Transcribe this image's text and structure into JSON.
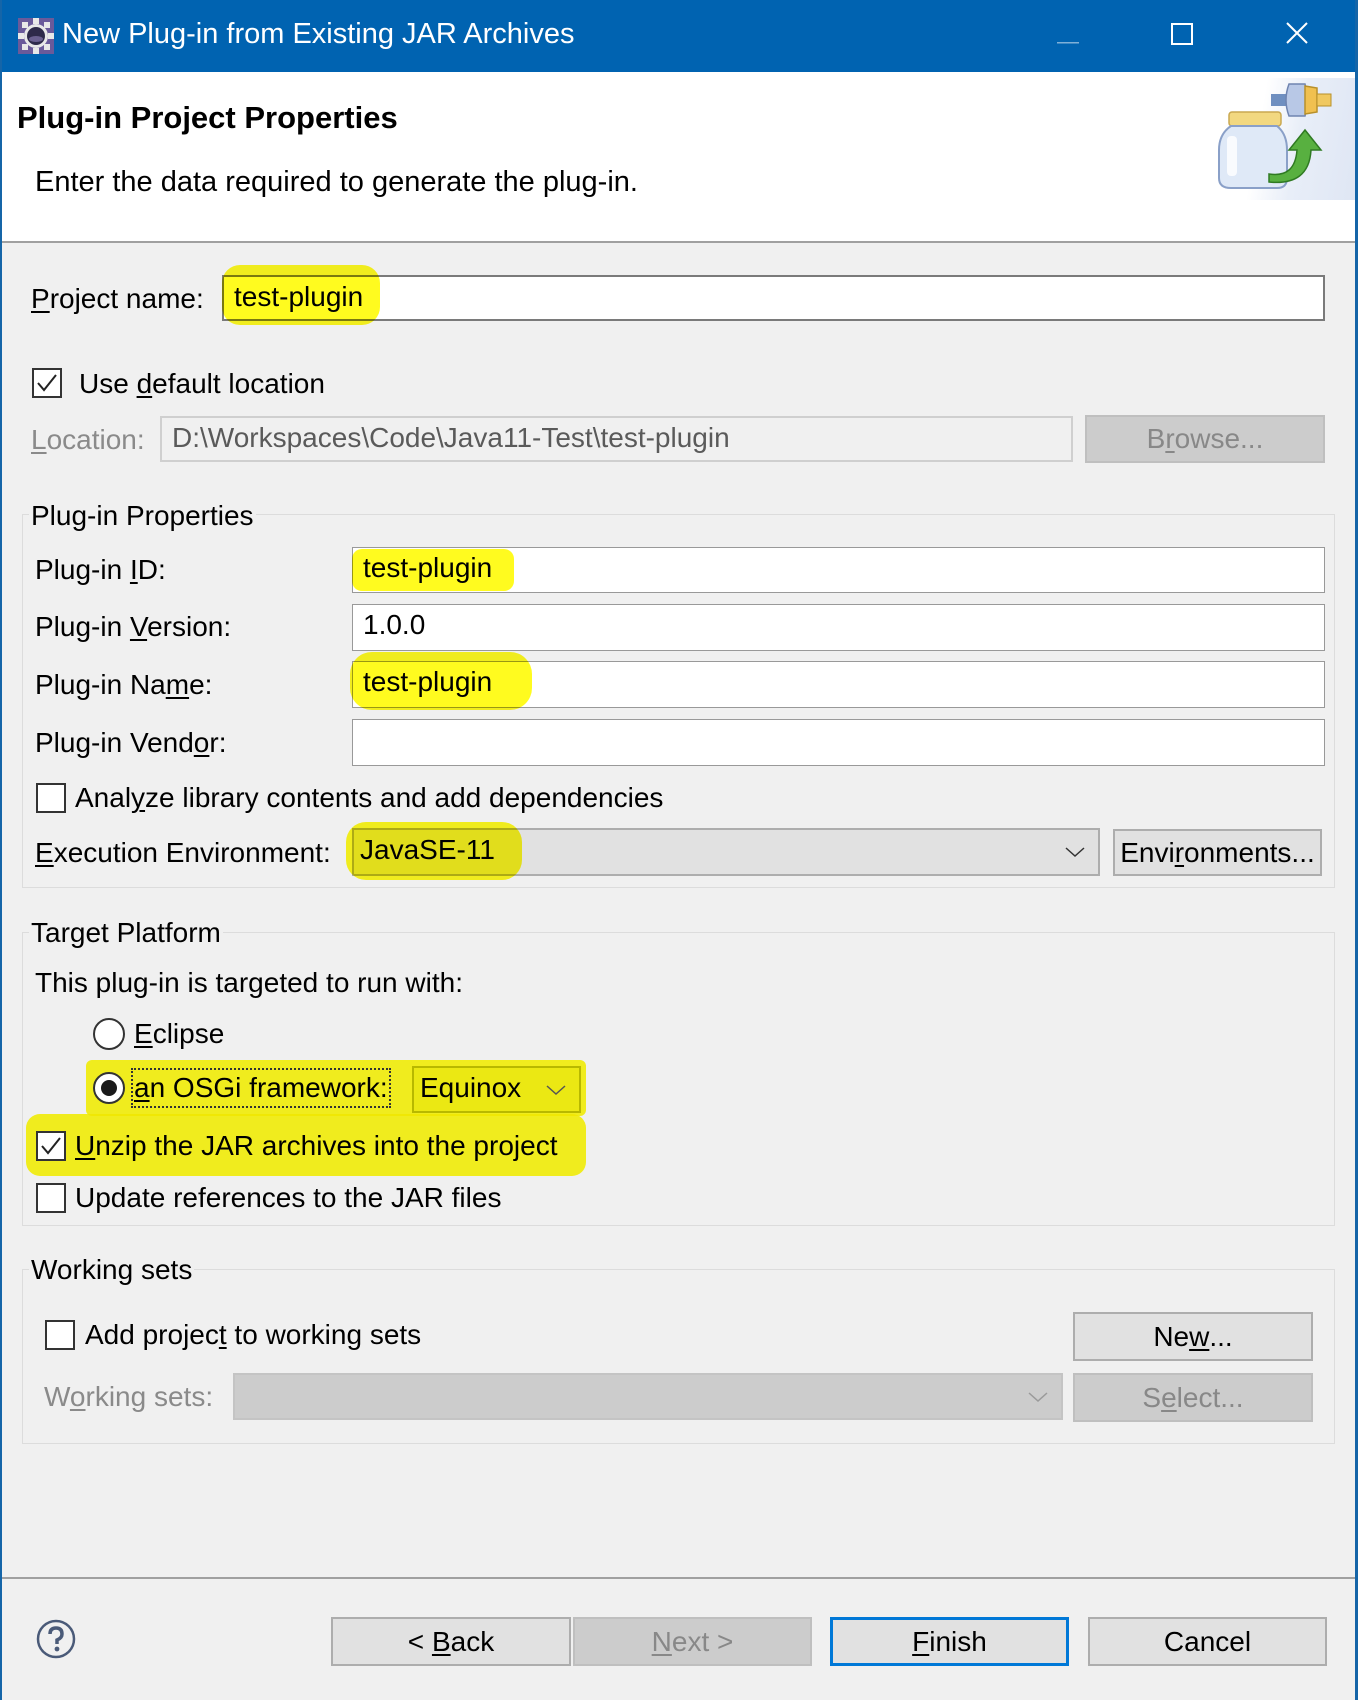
{
  "window": {
    "title": "New Plug-in from Existing JAR Archives",
    "app_icon": "eclipse-gear-icon",
    "controls": {
      "minimize": "minimize-icon",
      "maximize": "maximize-icon",
      "close": "close-icon"
    }
  },
  "header": {
    "title": "Plug-in Project Properties",
    "description": "Enter the data required to generate the plug-in.",
    "banner_icon": "jar-plugin-wizard-icon"
  },
  "project": {
    "name_label_mn": "P",
    "name_label_rest": "roject name:",
    "name_value": "test-plugin",
    "use_default_pre": "Use ",
    "use_default_mn": "d",
    "use_default_post": "efault location",
    "use_default_checked": true,
    "location_label_mn": "L",
    "location_label_rest": "ocation:",
    "location_value": "D:\\Workspaces\\Code\\Java11-Test\\test-plugin",
    "browse_pre": "B",
    "browse_mn": "r",
    "browse_post": "owse..."
  },
  "plugin_properties": {
    "group_title": "Plug-in Properties",
    "id_label_pre": "Plug-in ",
    "id_label_mn": "I",
    "id_label_post": "D:",
    "id_value": "test-plugin",
    "version_label_pre": "Plug-in ",
    "version_label_mn": "V",
    "version_label_post": "ersion:",
    "version_value": "1.0.0",
    "name_label_pre": "Plug-in Na",
    "name_label_mn": "m",
    "name_label_post": "e:",
    "name_value": "test-plugin",
    "vendor_label_pre": "Plug-in Vend",
    "vendor_label_mn": "o",
    "vendor_label_post": "r:",
    "vendor_value": "",
    "analyze_pre": "Anal",
    "analyze_mn": "y",
    "analyze_post": "ze library contents and add dependencies",
    "analyze_checked": false,
    "exec_env_label_mn": "E",
    "exec_env_label_rest": "xecution Environment:",
    "exec_env_value": "JavaSE-11",
    "environments_pre": "Envi",
    "environments_mn": "r",
    "environments_post": "onments..."
  },
  "target_platform": {
    "group_title": "Target Platform",
    "intro": "This plug-in is targeted to run with:",
    "eclipse_mn": "E",
    "eclipse_rest": "clipse",
    "eclipse_selected": false,
    "osgi_mn": "a",
    "osgi_rest": "n OSGi framework:",
    "osgi_selected": true,
    "osgi_framework_value": "Equinox",
    "unzip_mn": "U",
    "unzip_rest": "nzip the JAR archives into the project",
    "unzip_checked": true,
    "update_refs_label": "Update references to the JAR files",
    "update_refs_checked": false
  },
  "working_sets": {
    "group_title": "Working sets",
    "add_pre": "Add projec",
    "add_mn": "t",
    "add_post": " to working sets",
    "add_checked": false,
    "new_pre": "Ne",
    "new_mn": "w",
    "new_post": "...",
    "label_pre": "W",
    "label_mn": "o",
    "label_post": "rking sets:",
    "combo_value": "",
    "select_pre": "S",
    "select_mn": "e",
    "select_post": "lect..."
  },
  "footer": {
    "help_icon": "help-icon",
    "back_pre": "< ",
    "back_mn": "B",
    "back_post": "ack",
    "next_mn": "N",
    "next_post": "ext >",
    "finish_mn": "F",
    "finish_post": "inish",
    "cancel": "Cancel"
  },
  "colors": {
    "titlebar": "#0063b1",
    "highlight": "#ffff00",
    "dialog_bg": "#f0f0f0",
    "default_button_border": "#0078d7"
  }
}
